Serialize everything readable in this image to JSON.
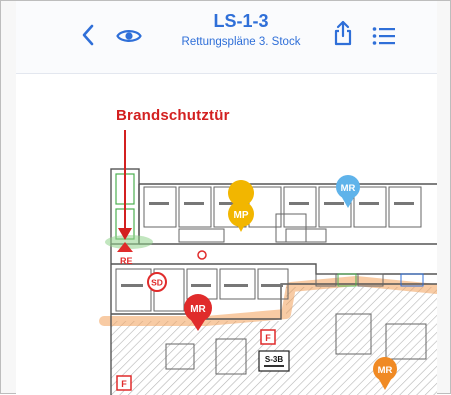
{
  "header": {
    "title": "LS-1-3",
    "subtitle": "Rettungspläne 3. Stock",
    "back_icon": "chevron-left-icon",
    "view_icon": "eye-icon",
    "share_icon": "share-icon",
    "list_icon": "list-icon"
  },
  "plan": {
    "callout": "Brandschutztür",
    "markers": {
      "mp": "MP",
      "mr_blue": "MR",
      "mr_red": "MR",
      "mr_orange": "MR",
      "sd": "SD",
      "re": "RE",
      "f1": "F",
      "f2": "F",
      "room": "S-3B"
    },
    "colors": {
      "accent": "#2f6fd8",
      "red": "#e02b2b",
      "yellow": "#f2b600",
      "light_blue": "#5fb3ea",
      "orange": "#f08a24",
      "green": "#4caf50"
    }
  }
}
